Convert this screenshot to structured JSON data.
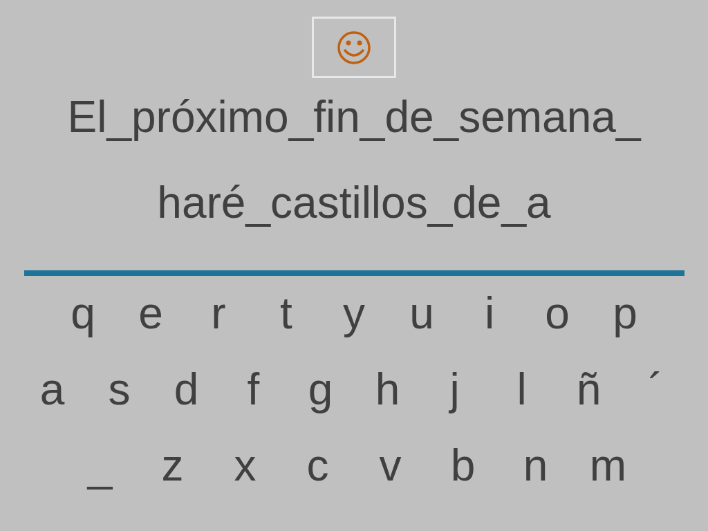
{
  "sentence_lines": [
    "El_próximo_fin_de_semana_",
    "haré_castillos_de_a"
  ],
  "keyboard_rows": [
    [
      "q",
      "e",
      "r",
      "t",
      "y",
      "u",
      "i",
      "o",
      "p"
    ],
    [
      "a",
      "s",
      "d",
      "f",
      "g",
      "h",
      "j",
      "l",
      "ñ",
      "´"
    ],
    [
      "_",
      "z",
      "x",
      "c",
      "v",
      "b",
      "n",
      "m"
    ]
  ]
}
